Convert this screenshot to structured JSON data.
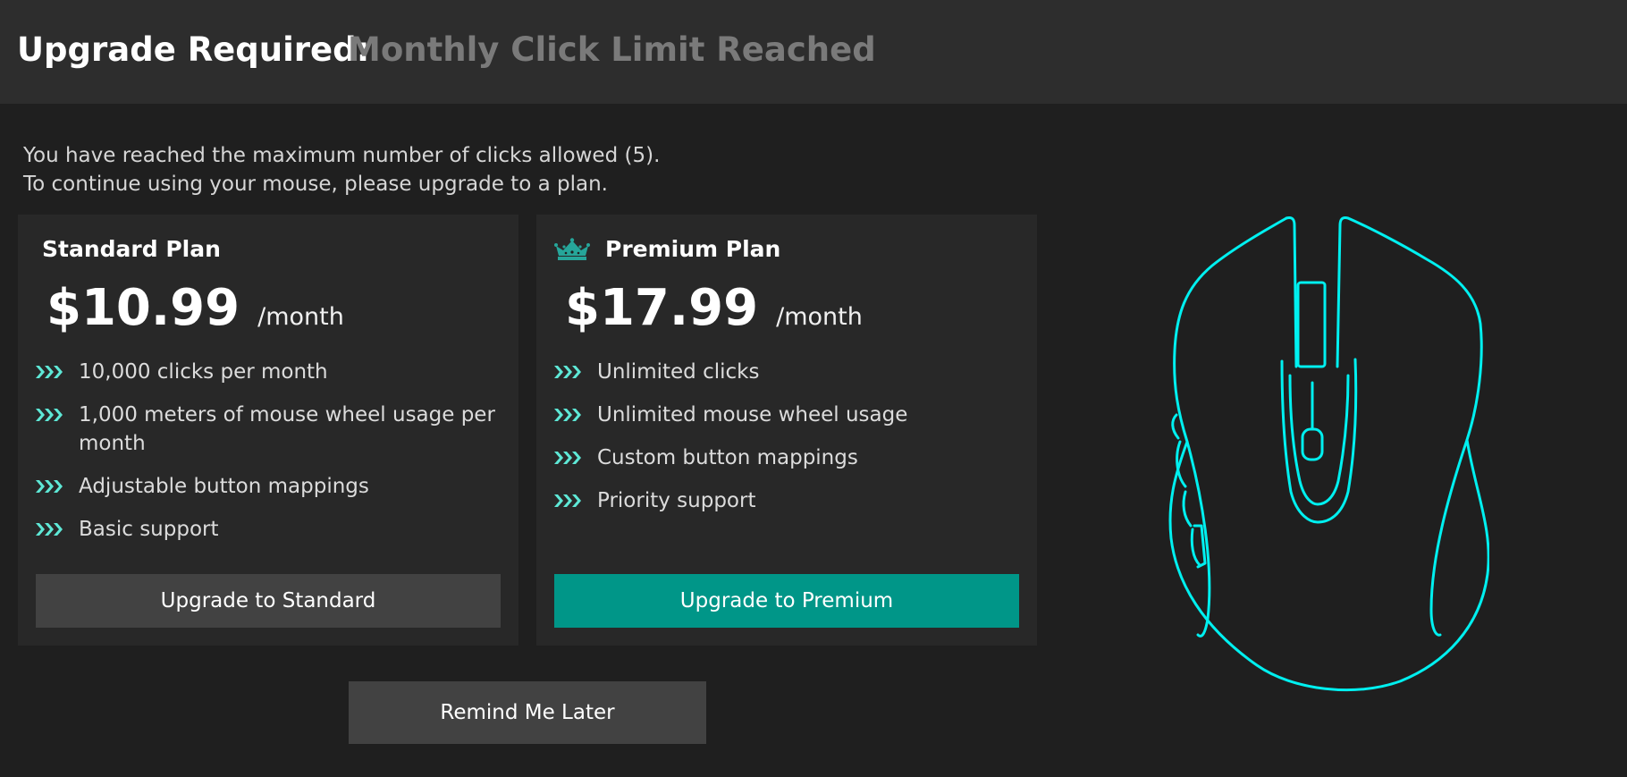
{
  "header": {
    "title": "Upgrade Required:",
    "subtitle": "Monthly Click Limit Reached"
  },
  "intro": {
    "line1": "You have reached the maximum number of clicks allowed (5).",
    "line2": "To continue using your mouse, please upgrade to a plan."
  },
  "plans": [
    {
      "name": "Standard Plan",
      "price": "$10.99",
      "period": "/month",
      "features": [
        "10,000 clicks per month",
        "1,000 meters of mouse wheel usage per month",
        "Adjustable button mappings",
        "Basic support"
      ],
      "button_label": "Upgrade to Standard"
    },
    {
      "name": "Premium Plan",
      "price": "$17.99",
      "period": "/month",
      "features": [
        "Unlimited clicks",
        "Unlimited mouse wheel usage",
        "Custom button mappings",
        "Priority support"
      ],
      "button_label": "Upgrade to Premium"
    }
  ],
  "remind_label": "Remind Me Later",
  "icons": {
    "feature_bullet": "triple-chevron-right-icon",
    "premium_badge": "crown-icon",
    "illustration": "computer-mouse-outline"
  },
  "colors": {
    "accent": "#009688",
    "bullet": "#5ee8d6",
    "mouse_outline": "#00f0f0",
    "background": "#1f1f1f",
    "header_background": "#2d2d2d",
    "card_background": "#282828",
    "secondary_button": "#424242"
  }
}
